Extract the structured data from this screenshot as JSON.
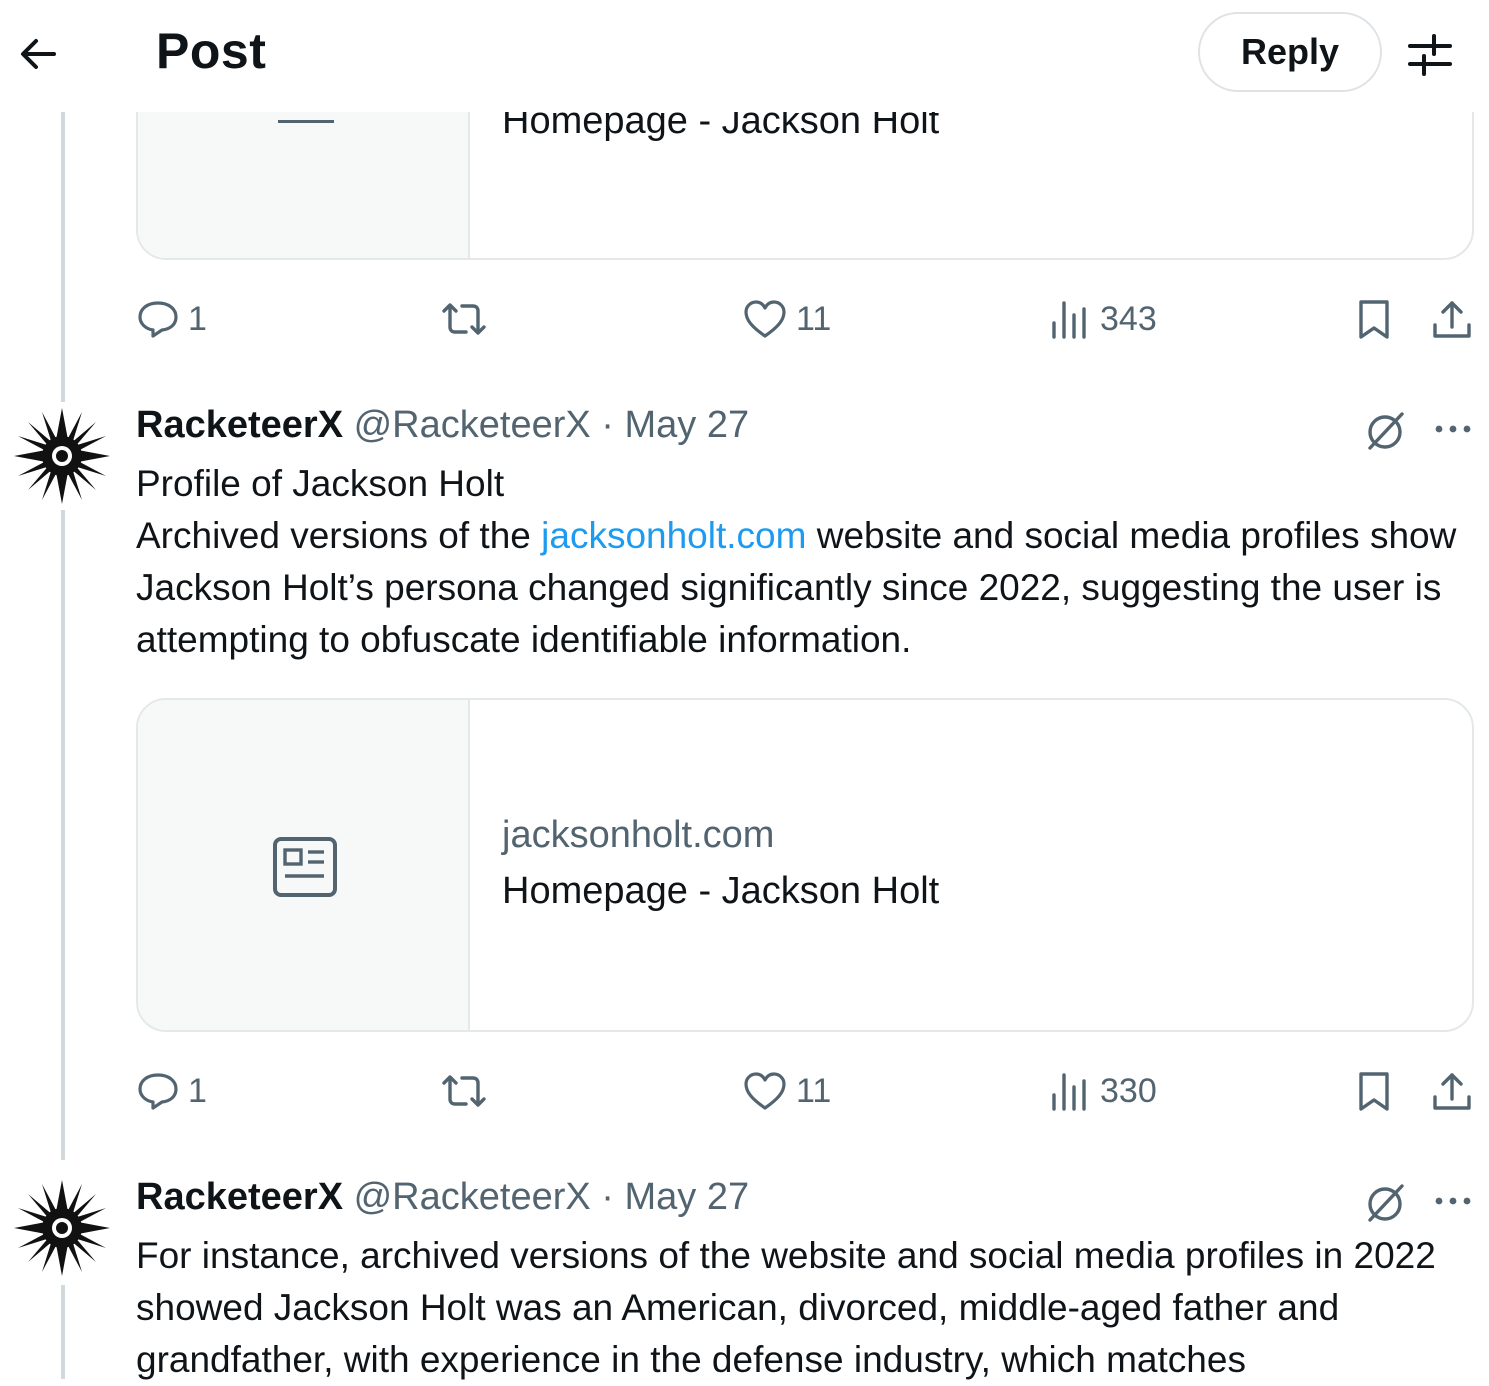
{
  "header": {
    "title": "Post",
    "reply_label": "Reply"
  },
  "top_card": {
    "title_partial": "Homepage - Jackson Holt"
  },
  "top_actions": {
    "replies": "1",
    "likes": "11",
    "views": "343"
  },
  "post1": {
    "name": "RacketeerX",
    "handle": "@RacketeerX",
    "separator": "·",
    "date": "May 27",
    "line1": "Profile of Jackson Holt",
    "text_before_link": "Archived versions of the ",
    "link": "jacksonholt.com",
    "text_after_link": " website and social media profiles show Jackson Holt’s persona changed significantly since 2022, suggesting the user is attempting to obfuscate identifiable information.",
    "card": {
      "domain": "jacksonholt.com",
      "title": "Homepage - Jackson Holt"
    },
    "actions": {
      "replies": "1",
      "likes": "11",
      "views": "330"
    }
  },
  "post2": {
    "name": "RacketeerX",
    "handle": "@RacketeerX",
    "separator": "·",
    "date": "May 27",
    "text": "For instance, archived versions of the website and social media profiles in 2022 showed Jackson Holt was an American, divorced, middle-aged father and grandfather, with experience in the defense industry, which matches"
  },
  "icons": [
    "back-arrow-icon",
    "settings-sliders-icon",
    "reply-icon",
    "repost-icon",
    "like-icon",
    "views-icon",
    "bookmark-icon",
    "share-icon",
    "grok-icon",
    "more-icon",
    "article-icon"
  ]
}
